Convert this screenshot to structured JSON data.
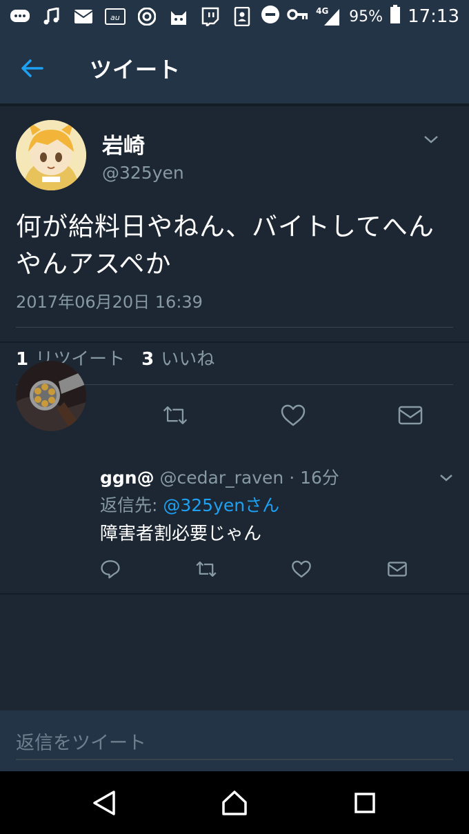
{
  "status_bar": {
    "network": "4G",
    "battery": "95%",
    "time": "17:13",
    "icons": [
      "messages-icon",
      "music-icon",
      "au-mail-icon",
      "au-icon",
      "chrome-icon",
      "cat-app-icon",
      "twitch-icon",
      "contacts-icon",
      "do-not-disturb-icon",
      "key-icon",
      "signal-icon",
      "battery-icon"
    ]
  },
  "header": {
    "title": "ツイート"
  },
  "tweet": {
    "name": "岩崎",
    "handle": "@325yen",
    "text": "何が給料日やねん、バイトしてへんやんアスペか",
    "timestamp": "2017年06月20日 16:39",
    "retweet_count": "1",
    "retweet_label": "リツイート",
    "like_count": "3",
    "like_label": "いいね"
  },
  "reply": {
    "name": "ggn@",
    "meta": " @cedar_raven · 16分",
    "reply_to_label": "返信先: ",
    "reply_to_mention": "@325yenさん",
    "text": "障害者割必要じゃん"
  },
  "composer": {
    "placeholder": "返信をツイート"
  },
  "colors": {
    "background": "#1c2733",
    "bar": "#243447",
    "accent": "#1da1f2",
    "secondary_text": "#8899a6"
  }
}
